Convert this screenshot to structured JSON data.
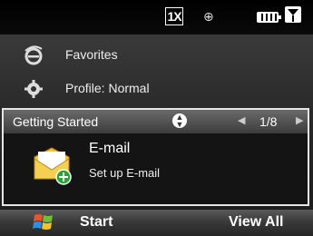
{
  "status": {
    "network": "1X",
    "icons": [
      "network-1x-icon",
      "gps-icon",
      "battery-icon",
      "signal-icon"
    ]
  },
  "home": {
    "favorites_label": "Favorites",
    "profile_label": "Profile: Normal"
  },
  "getting_started": {
    "title": "Getting Started",
    "pager": "1/8",
    "item_title": "E-mail",
    "item_subtitle": "Set up E-mail"
  },
  "softkeys": {
    "left": "Start",
    "right": "View All"
  },
  "colors": {
    "panel_border": "#e6e6e6",
    "header_bg": "#4a4a4a",
    "accent_green": "#2aa33a",
    "envelope_yellow": "#f3c13a"
  }
}
